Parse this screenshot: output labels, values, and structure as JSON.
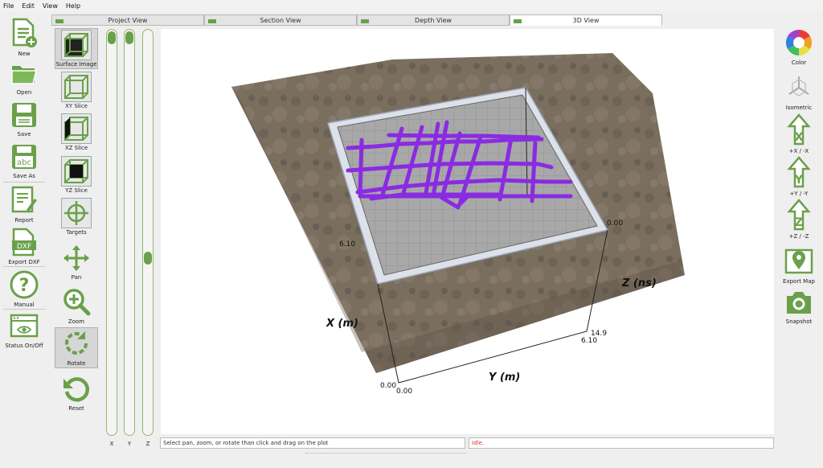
{
  "menu": [
    "File",
    "Edit",
    "View",
    "Help"
  ],
  "tabs": [
    {
      "label": "Project View",
      "active": false
    },
    {
      "label": "Section View",
      "active": false
    },
    {
      "label": "Depth View",
      "active": false
    },
    {
      "label": "3D View",
      "active": true
    }
  ],
  "left_toolbar": {
    "new": "New",
    "open": "Open",
    "save": "Save",
    "save_as": "Save As",
    "report": "Report",
    "export_dxf": "Export DXF",
    "manual": "Manual",
    "status_toggle": "Status On/Off"
  },
  "view_toolbar": {
    "surface_image": "Surface Image",
    "xy_slice": "XY Slice",
    "xz_slice": "XZ Slice",
    "yz_slice": "YZ Slice",
    "targets": "Targets",
    "pan": "Pan",
    "zoom": "Zoom",
    "rotate": "Rotate",
    "reset": "Reset"
  },
  "sliders": {
    "x": {
      "label": "X",
      "level": 0.0
    },
    "y": {
      "label": "Y",
      "level": 0.0
    },
    "z": {
      "label": "Z",
      "level": 0.58
    }
  },
  "right_toolbar": {
    "color": "Color",
    "isometric": "Isometric",
    "x_view": "+X / -X",
    "y_view": "+Y / -Y",
    "z_view": "+Z / -Z",
    "export_map": "Export Map",
    "snapshot": "Snapshot"
  },
  "plot": {
    "x_axis_label": "X (m)",
    "y_axis_label": "Y (m)",
    "z_axis_label": "Z (ns)",
    "x_max": "6.10",
    "y_max": "6.10",
    "z_max": "14.9",
    "z_min": "0.00",
    "origin_x": "0.00",
    "origin_y": "0.00"
  },
  "status": {
    "hint": "Select pan, zoom, or rotate than click and drag on the plot",
    "state": "Idle."
  },
  "colors": {
    "accent_green": "#6aa04a",
    "target_purple": "#8a2be2",
    "status_red": "#d33333"
  }
}
